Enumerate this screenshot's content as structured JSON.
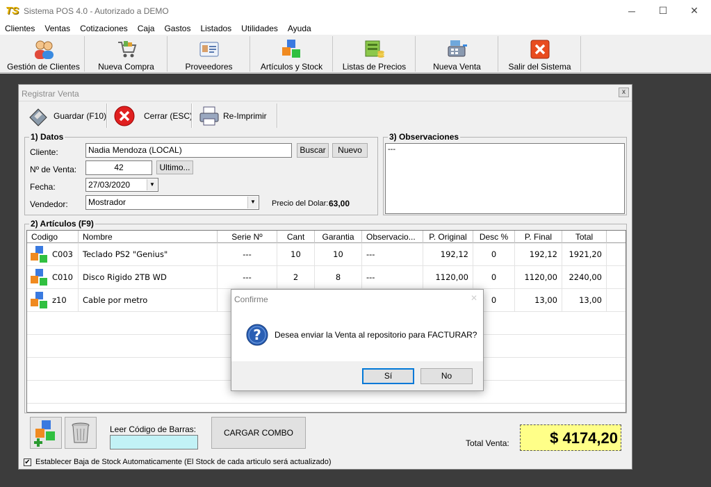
{
  "window": {
    "logo": "TS",
    "title": "Sistema POS 4.0 - Autorizado a DEMO",
    "minimize": "─",
    "maximize": "☐",
    "close": "✕"
  },
  "menu": [
    "Clientes",
    "Ventas",
    "Cotizaciones",
    "Caja",
    "Gastos",
    "Listados",
    "Utilidades",
    "Ayuda"
  ],
  "toolbar": [
    {
      "label": "Gestión de Clientes",
      "icon": "clients-icon"
    },
    {
      "label": "Nueva Compra",
      "icon": "cart-icon"
    },
    {
      "label": "Proveedores",
      "icon": "id-card-icon"
    },
    {
      "label": "Artículos y Stock",
      "icon": "cubes-icon"
    },
    {
      "label": "Listas de Precios",
      "icon": "price-list-icon"
    },
    {
      "label": "Nueva Venta",
      "icon": "register-icon"
    },
    {
      "label": "Salir del Sistema",
      "icon": "exit-icon"
    }
  ],
  "child": {
    "title": "Registrar Venta",
    "close": "x",
    "save_label": "Guardar (F10)",
    "close_label": "Cerrar (ESC)",
    "reprint_label": "Re-Imprimir"
  },
  "datos": {
    "legend": "1) Datos",
    "cliente_label": "Cliente:",
    "cliente_value": "Nadia Mendoza (LOCAL)",
    "buscar": "Buscar",
    "nuevo": "Nuevo",
    "nventa_label": "Nº de Venta:",
    "nventa_value": "42",
    "ultimo": "Ultimo...",
    "fecha_label": "Fecha:",
    "fecha_value": "27/03/2020",
    "vendedor_label": "Vendedor:",
    "vendedor_value": "Mostrador",
    "dolar_label": "Precio del Dolar:",
    "dolar_value": "63,00"
  },
  "observaciones": {
    "legend": "3) Observaciones",
    "value": "---"
  },
  "articulos": {
    "legend": "2) Artículos (F9)",
    "columns": [
      "Codigo",
      "Nombre",
      "Serie Nº",
      "Cant",
      "Garantia",
      "Observacio...",
      "P. Original",
      "Desc %",
      "P. Final",
      "Total"
    ],
    "rows": [
      {
        "codigo": "C003",
        "nombre": "Teclado PS2 \"Genius\"",
        "serie": "---",
        "cant": "10",
        "garantia": "10",
        "obs": "---",
        "p_original": "192,12",
        "desc": "0",
        "p_final": "192,12",
        "total": "1921,20"
      },
      {
        "codigo": "C010",
        "nombre": "Disco Rigido 2TB WD",
        "serie": "---",
        "cant": "2",
        "garantia": "8",
        "obs": "---",
        "p_original": "1120,00",
        "desc": "0",
        "p_final": "1120,00",
        "total": "2240,00"
      },
      {
        "codigo": "z10",
        "nombre": "Cable por metro",
        "serie": "",
        "cant": "",
        "garantia": "",
        "obs": "",
        "p_original": "",
        "desc": "0",
        "p_final": "13,00",
        "total": "13,00"
      }
    ]
  },
  "bottom": {
    "barcode_label": "Leer Código de Barras:",
    "barcode_value": "",
    "combo": "CARGAR COMBO",
    "total_label": "Total Venta:",
    "total_value": "$ 4174,20",
    "stock_check": "✔",
    "stock_label": "Establecer Baja de Stock Automaticamente (El Stock de cada articulo será actualizado)"
  },
  "dialog": {
    "title": "Confirme",
    "close": "✕",
    "icon_glyph": "?",
    "message": "Desea enviar la Venta al repositorio para FACTURAR?",
    "yes": "Sí",
    "no": "No"
  }
}
